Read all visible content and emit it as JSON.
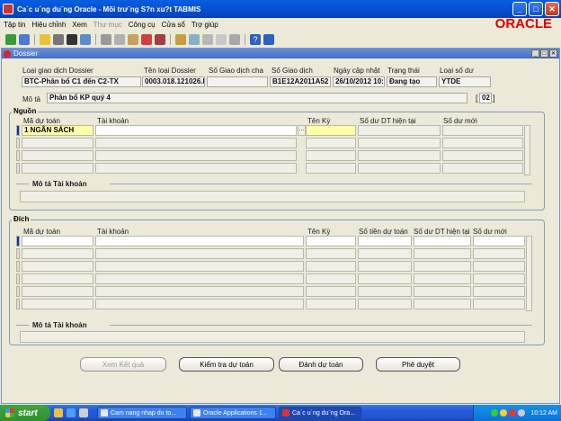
{
  "window": {
    "title": "Ca´c u´ng du¨ng Oracle - Mõi trư¨ng S?n xu?t TABMIS"
  },
  "menu": {
    "items": [
      {
        "label": "Tập tin",
        "disabled": false
      },
      {
        "label": "Hiệu chỉnh",
        "disabled": false
      },
      {
        "label": "Xem",
        "disabled": false
      },
      {
        "label": "Thư mục",
        "disabled": true
      },
      {
        "label": "Công cụ",
        "disabled": false
      },
      {
        "label": "Cửa sổ",
        "disabled": false
      },
      {
        "label": "Trợ giúp",
        "disabled": false
      }
    ]
  },
  "brand": {
    "logo_text": "ORACLE",
    "color": "#dd0000"
  },
  "toolbar": {
    "icons": [
      "new-icon",
      "open-icon",
      "save-icon",
      "find-icon",
      "print-icon",
      "navigator-icon",
      "cut-icon",
      "copy-icon",
      "paste-icon",
      "clear-icon",
      "delete-icon",
      "edit-icon",
      "attachments-icon",
      "folder-icon",
      "tools-icon",
      "translate-icon",
      "help-icon",
      "context-help-icon"
    ]
  },
  "dossier": {
    "window_title": "Dossier",
    "headers": {
      "loai_gd": "Loại giao dịch Dossier",
      "ten_loai": "Tên loại Dossier",
      "so_gd_cha": "Số Giao dịch cha",
      "so_gd": "Số Giao dịch",
      "ngay_cap_nhat": "Ngày cập nhật",
      "trang_thai": "Trạng thái",
      "loai_so_du": "Loại số dư"
    },
    "values": {
      "loai_gd": "BTC-Phân bổ C1 đến C2-TX",
      "ten_loai": "0003.018.121026.k",
      "so_gd_cha": "",
      "so_gd": "B1E12A2011A52",
      "ngay_cap_nhat": "26/10/2012 10:0",
      "trang_thai": "Đang tạo",
      "loai_so_du": "YTDE"
    },
    "mota_label": "Mô tả",
    "mota_value": "Phân bổ KP quý 4",
    "bracket_value": "02",
    "bracket_open": "[",
    "bracket_close": "]"
  },
  "nguon": {
    "title": "Nguồn",
    "columns": {
      "ma_du_toan": "Mã dự toán",
      "tai_khoan": "Tài khoản",
      "ten_ky": "Tên Kỳ",
      "so_du_dt": "Số dư DT hiện tại",
      "so_du_moi": "Số dư mới"
    },
    "rows": [
      {
        "ma": "1 NGÂN SÁCH",
        "tk": "",
        "ky": "",
        "dt": "",
        "moi": ""
      },
      {
        "ma": "",
        "tk": "",
        "ky": "",
        "dt": "",
        "moi": ""
      },
      {
        "ma": "",
        "tk": "",
        "ky": "",
        "dt": "",
        "moi": ""
      },
      {
        "ma": "",
        "tk": "",
        "ky": "",
        "dt": "",
        "moi": ""
      }
    ],
    "lov_button": "...",
    "mota_tk_label": "Mô tả Tài khoản"
  },
  "dich": {
    "title": "Đích",
    "columns": {
      "ma_du_toan": "Mã dự toán",
      "tai_khoan": "Tài khoản",
      "ten_ky": "Tên Kỳ",
      "so_tien": "Số tiền dự toán",
      "so_du_dt": "Số dư DT hiện tại",
      "so_du_moi": "Số dư mới"
    },
    "rows": 6,
    "mota_tk_label": "Mô tả Tài khoản"
  },
  "buttons": {
    "xem_ket_qua": "Xem Kết quả",
    "kiem_tra": "Kiểm tra dự toán",
    "danh_du_toan": "Đánh dự toán",
    "phe_duyet": "Phê duyệt"
  },
  "taskbar": {
    "start": "start",
    "tasks": [
      {
        "label": "Cam nang nhap du to...",
        "active": false
      },
      {
        "label": "Oracle Applications 1...",
        "active": false
      },
      {
        "label": "Ca´c u´ng du¨ng Ora...",
        "active": true
      }
    ],
    "clock": "10:12 AM"
  }
}
